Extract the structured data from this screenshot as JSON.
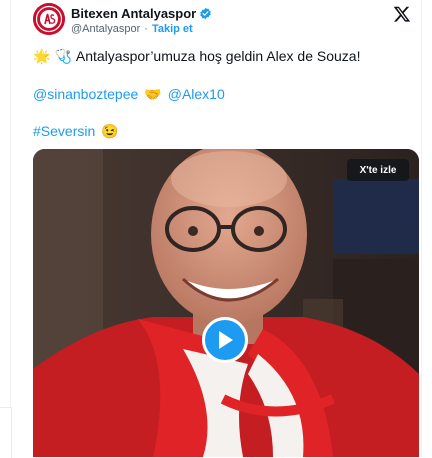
{
  "tweet": {
    "author_name": "Bitexen Antalyaspor",
    "handle": "@Antalyaspor",
    "separator": "·",
    "follow_label": "Takip et",
    "lines": {
      "line1_text": "Antalyaspor’umuza hoş geldin Alex de Souza!",
      "mention_1": "@sinanboztepee",
      "mention_2": "@Alex10",
      "hashtag": "#Seversin"
    },
    "emojis": {
      "star": "🌟",
      "stethoscope": "🩺",
      "handshake": "🤝",
      "wink": "😉"
    }
  },
  "video": {
    "watch_label": "X'te izle",
    "play_icon": "play-icon"
  },
  "colors": {
    "accent": "#1d9bf0",
    "club_red": "#c8102e",
    "text": "#0f1419",
    "muted": "#536471"
  }
}
